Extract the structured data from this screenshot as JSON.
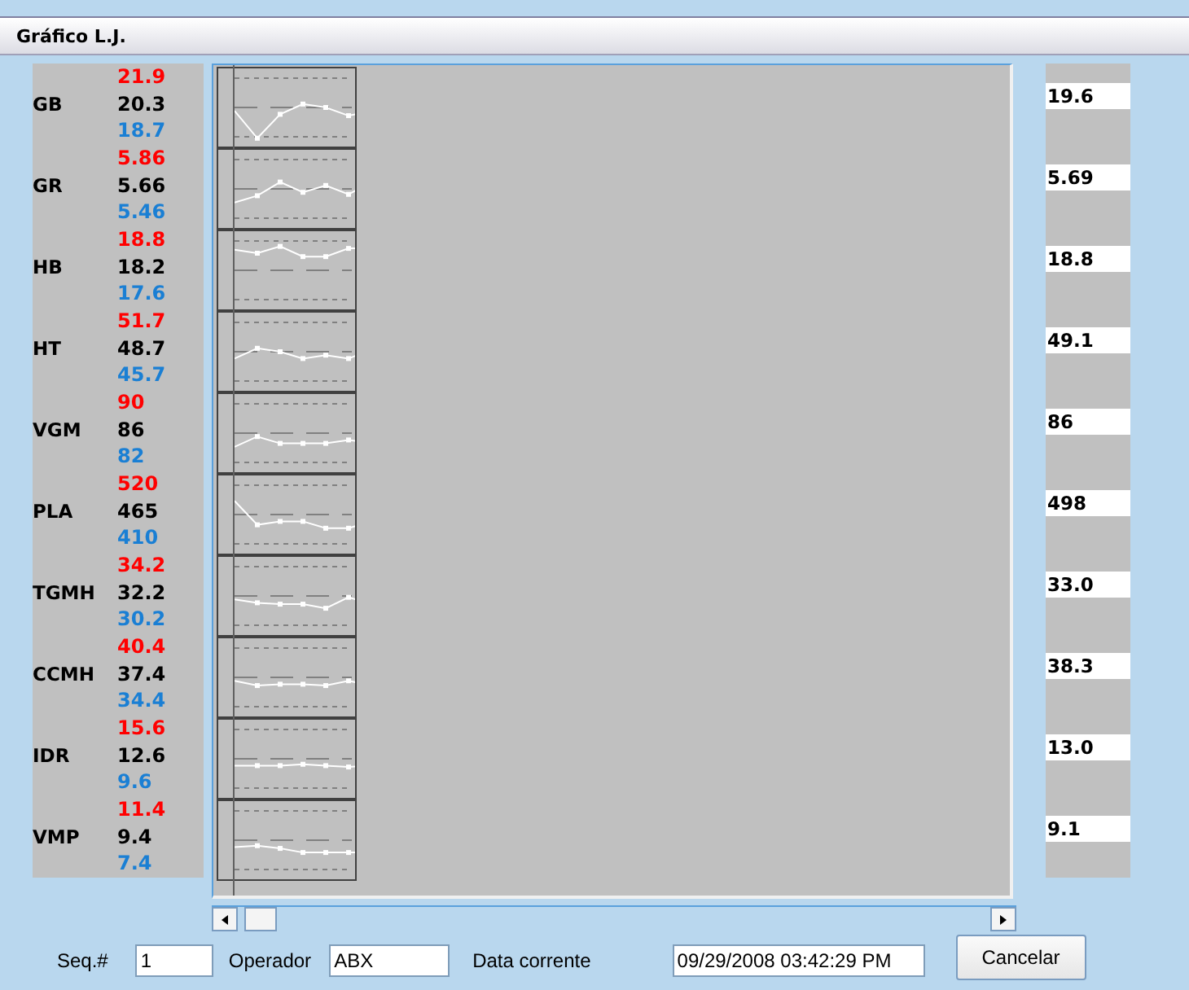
{
  "window": {
    "title": "Gráfico L.J."
  },
  "parameters": [
    {
      "name": "GB",
      "high": "21.9",
      "mean": "20.3",
      "low": "18.7",
      "value": "19.6"
    },
    {
      "name": "GR",
      "high": "5.86",
      "mean": "5.66",
      "low": "5.46",
      "value": "5.69"
    },
    {
      "name": "HB",
      "high": "18.8",
      "mean": "18.2",
      "low": "17.6",
      "value": "18.8"
    },
    {
      "name": "HT",
      "high": "51.7",
      "mean": "48.7",
      "low": "45.7",
      "value": "49.1"
    },
    {
      "name": "VGM",
      "high": "90",
      "mean": "86",
      "low": "82",
      "value": "86"
    },
    {
      "name": "PLA",
      "high": "520",
      "mean": "465",
      "low": "410",
      "value": "498"
    },
    {
      "name": "TGMH",
      "high": "34.2",
      "mean": "32.2",
      "low": "30.2",
      "value": "33.0"
    },
    {
      "name": "CCMH",
      "high": "40.4",
      "mean": "37.4",
      "low": "34.4",
      "value": "38.3"
    },
    {
      "name": "IDR",
      "high": "15.6",
      "mean": "12.6",
      "low": "9.6",
      "value": "13.0"
    },
    {
      "name": "VMP",
      "high": "11.4",
      "mean": "9.4",
      "low": "7.4",
      "value": "9.1"
    }
  ],
  "footer": {
    "seq_label": "Seq.#",
    "seq": "1",
    "operator_label": "Operador",
    "operator": "ABX",
    "date_label": "Data corrente",
    "date": "09/29/2008 03:42:29 PM"
  },
  "buttons": [
    "Cancelar"
  ]
}
